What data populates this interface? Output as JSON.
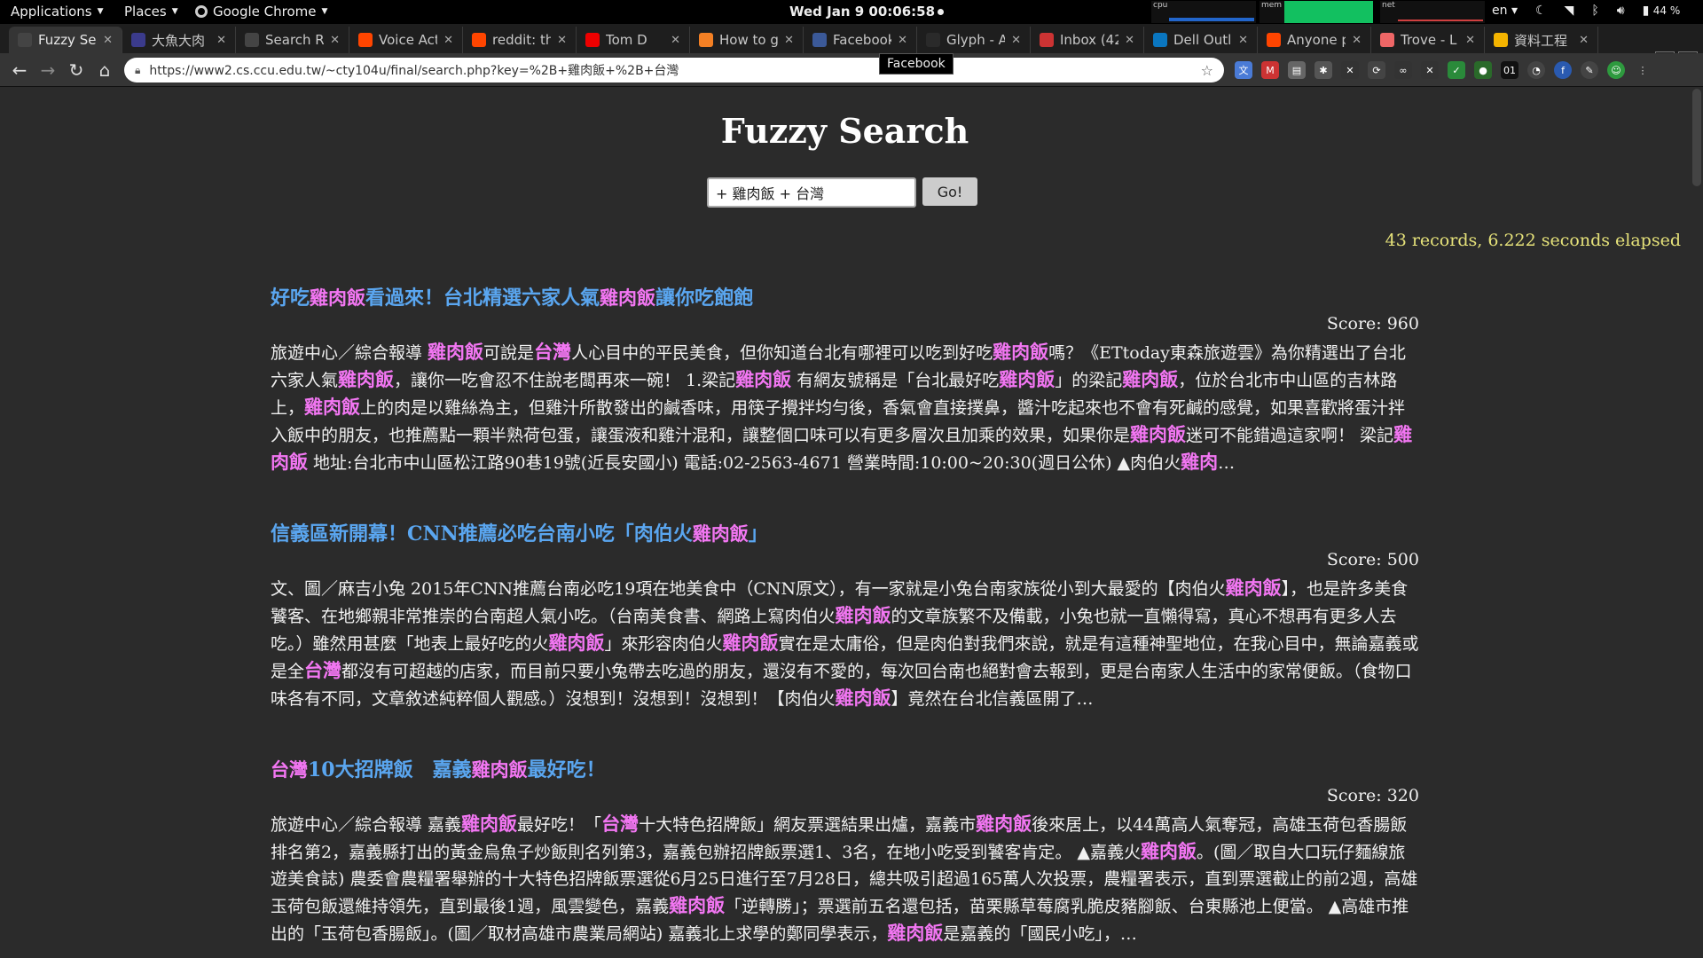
{
  "topbar": {
    "applications": "Applications",
    "places": "Places",
    "chrome": "Google Chrome",
    "clock": "Wed Jan 9  00:06:58",
    "monitors": [
      "cpu",
      "mem",
      "net"
    ],
    "language": "en",
    "battery": "44 %"
  },
  "tabs": [
    {
      "title": "Fuzzy Se",
      "color": "#444",
      "icon": "page-icon"
    },
    {
      "title": "大魚大肉",
      "color": "#3b3b8c",
      "icon": "site-icon"
    },
    {
      "title": "Search R",
      "color": "#444",
      "icon": "page-icon"
    },
    {
      "title": "Voice Act",
      "color": "#ff4500",
      "icon": "reddit-icon"
    },
    {
      "title": "reddit: th",
      "color": "#ff4500",
      "icon": "reddit-icon"
    },
    {
      "title": "Tom D",
      "color": "#e00",
      "icon": "youtube-icon"
    },
    {
      "title": "How to g",
      "color": "#f48024",
      "icon": "stackoverflow-icon"
    },
    {
      "title": "Facebook",
      "color": "#3b5998",
      "icon": "facebook-icon"
    },
    {
      "title": "Glyph - A",
      "color": "#2a2a2a",
      "icon": "glyph-icon"
    },
    {
      "title": "Inbox (42",
      "color": "#c33",
      "icon": "gmail-icon"
    },
    {
      "title": "Dell Outl",
      "color": "#0a76c0",
      "icon": "dell-icon"
    },
    {
      "title": "Anyone p",
      "color": "#ff4500",
      "icon": "reddit-icon"
    },
    {
      "title": "Trove - L",
      "color": "#e66",
      "icon": "trove-icon"
    },
    {
      "title": "資料工程",
      "color": "#f4b400",
      "icon": "slides-icon"
    }
  ],
  "tooltip": "Facebook",
  "address": {
    "url": "https://www2.cs.ccu.edu.tw/~cty104u/final/search.php?key=%2B+雞肉飯+%2B+台灣"
  },
  "page": {
    "title": "Fuzzy Search",
    "search_value": "+ 雞肉飯 + 台灣",
    "go_label": "Go!",
    "stats": "43 records, 6.222 seconds elapsed"
  },
  "results": [
    {
      "title": [
        [
          "t",
          "好吃"
        ],
        [
          "h",
          "雞肉飯"
        ],
        [
          "t",
          "看過來！台北精選六家人氣"
        ],
        [
          "h",
          "雞肉飯"
        ],
        [
          "t",
          "讓你吃飽飽"
        ]
      ],
      "score": "Score: 960",
      "body": [
        [
          "t",
          "旅遊中心／綜合報導 "
        ],
        [
          "h",
          "雞肉飯"
        ],
        [
          "t",
          "可說是"
        ],
        [
          "h",
          "台灣"
        ],
        [
          "t",
          "人心目中的平民美食，但你知道台北有哪裡可以吃到好吃"
        ],
        [
          "h",
          "雞肉飯"
        ],
        [
          "t",
          "嗎？《ETtoday東森旅遊雲》為你精選出了台北六家人氣"
        ],
        [
          "h",
          "雞肉飯"
        ],
        [
          "t",
          "，讓你一吃會忍不住說老闆再來一碗！ 1.梁記"
        ],
        [
          "h",
          "雞肉飯"
        ],
        [
          "t",
          " 有網友號稱是「台北最好吃"
        ],
        [
          "h",
          "雞肉飯"
        ],
        [
          "t",
          "」的梁記"
        ],
        [
          "h",
          "雞肉飯"
        ],
        [
          "t",
          "，位於台北市中山區的吉林路上，"
        ],
        [
          "h",
          "雞肉飯"
        ],
        [
          "t",
          "上的肉是以雞絲為主，但雞汁所散發出的鹹香味，用筷子攪拌均勻後，香氣會直接撲鼻，醬汁吃起來也不會有死鹹的感覺，如果喜歡將蛋汁拌入飯中的朋友，也推薦點一顆半熟荷包蛋，讓蛋液和雞汁混和，讓整個口味可以有更多層次且加乘的效果，如果你是"
        ],
        [
          "h",
          "雞肉飯"
        ],
        [
          "t",
          "迷可不能錯過這家啊！ 梁記"
        ],
        [
          "h",
          "雞肉飯"
        ],
        [
          "t",
          " 地址:台北市中山區松江路90巷19號(近長安國小) 電話:02-2563-4671 營業時間:10:00~20:30(週日公休) ▲肉伯火"
        ],
        [
          "h",
          "雞肉"
        ],
        [
          "t",
          "…"
        ]
      ]
    },
    {
      "title": [
        [
          "t",
          "信義區新開幕！CNN推薦必吃台南小吃「肉伯火"
        ],
        [
          "h",
          "雞肉飯"
        ],
        [
          "t",
          "」"
        ]
      ],
      "score": "Score: 500",
      "body": [
        [
          "t",
          "文、圖／麻吉小兔 2015年CNN推薦台南必吃19項在地美食中（CNN原文），有一家就是小兔台南家族從小到大最愛的【肉伯火"
        ],
        [
          "h",
          "雞肉飯"
        ],
        [
          "t",
          "】，也是許多美食饕客、在地鄉親非常推崇的台南超人氣小吃。（台南美食書、網路上寫肉伯火"
        ],
        [
          "h",
          "雞肉飯"
        ],
        [
          "t",
          "的文章族繁不及備載，小兔也就一直懶得寫，真心不想再有更多人去吃。）雖然用甚麼「地表上最好吃的火"
        ],
        [
          "h",
          "雞肉飯"
        ],
        [
          "t",
          "」來形容肉伯火"
        ],
        [
          "h",
          "雞肉飯"
        ],
        [
          "t",
          "實在是太庸俗，但是肉伯對我們來說，就是有這種神聖地位，在我心目中，無論嘉義或是全"
        ],
        [
          "h",
          "台灣"
        ],
        [
          "t",
          "都沒有可超越的店家，而目前只要小兔帶去吃過的朋友，還沒有不愛的，每次回台南也絕對會去報到，更是台南家人生活中的家常便飯。（食物口味各有不同，文章敘述純粹個人觀感。）沒想到！沒想到！沒想到！【肉伯火"
        ],
        [
          "h",
          "雞肉飯"
        ],
        [
          "t",
          "】竟然在台北信義區開了…"
        ]
      ]
    },
    {
      "title": [
        [
          "h",
          "台灣"
        ],
        [
          "t",
          "10大招牌飯　嘉義"
        ],
        [
          "h",
          "雞肉飯"
        ],
        [
          "t",
          "最好吃！"
        ]
      ],
      "score": "Score: 320",
      "body": [
        [
          "t",
          "旅遊中心／綜合報導 嘉義"
        ],
        [
          "h",
          "雞肉飯"
        ],
        [
          "t",
          "最好吃！「"
        ],
        [
          "h",
          "台灣"
        ],
        [
          "t",
          "十大特色招牌飯」網友票選結果出爐，嘉義市"
        ],
        [
          "h",
          "雞肉飯"
        ],
        [
          "t",
          "後來居上，以44萬高人氣奪冠，高雄玉荷包香腸飯排名第2，嘉義縣打出的黃金烏魚子炒飯則名列第3，嘉義包辦招牌飯票選1、3名，在地小吃受到饕客肯定。 ▲嘉義火"
        ],
        [
          "h",
          "雞肉飯"
        ],
        [
          "t",
          "。(圖／取自大口玩仔麵線旅遊美食誌) 農委會農糧署舉辦的十大特色招牌飯票選從6月25日進行至7月28日，總共吸引超過165萬人次投票，農糧署表示，直到票選截止的前2週，高雄玉荷包飯還維持領先，直到最後1週，風雲變色，嘉義"
        ],
        [
          "h",
          "雞肉飯"
        ],
        [
          "t",
          "「逆轉勝」；票選前五名還包括，苗栗縣草莓腐乳脆皮豬腳飯、台東縣池上便當。 ▲高雄市推出的「玉荷包香腸飯」。(圖／取材高雄市農業局網站) 嘉義北上求學的鄭同學表示，"
        ],
        [
          "h",
          "雞肉飯"
        ],
        [
          "t",
          "是嘉義的「國民小吃」，…"
        ]
      ]
    }
  ],
  "colors": {
    "title": "#5aa6f0",
    "highlight": "#f276f2",
    "stats": "#e6e27a"
  }
}
